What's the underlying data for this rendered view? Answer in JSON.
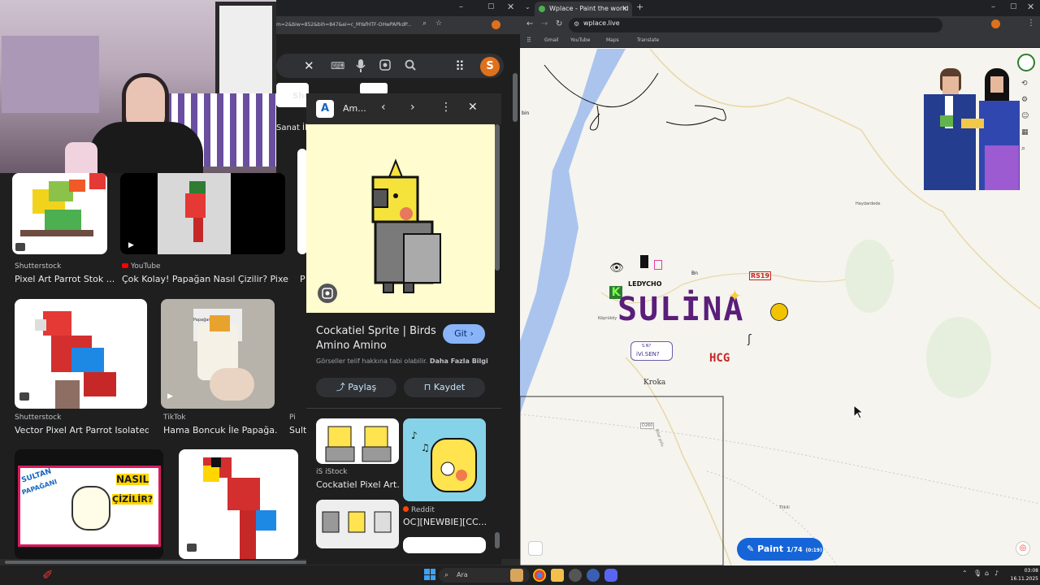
{
  "left_browser": {
    "url_fragment": "m=2&biw=852&bih=847&ei=c_MYafHTF-OHwPAPkdP...",
    "profile_initial": "S",
    "visible_tab_fragments": [
      "Shu",
      "Sanat İl"
    ],
    "results": [
      {
        "source": "Shutterstock",
        "title": "Pixel Art Parrot Stok ..."
      },
      {
        "source": "YouTube",
        "title": "Çok Kolay! Papağan Nasıl Çizilir? Pixe..."
      },
      {
        "source": "Shutterstock",
        "title": "Vector Pixel Art Parrot Isolated ..."
      },
      {
        "source": "TikTok",
        "title": "Hama Boncuk İle Papağa..."
      },
      {
        "source": "Pi",
        "title": "Sulta"
      },
      {
        "source": "P",
        "title": "P"
      }
    ],
    "thumb_texts": {
      "sultan_title": [
        "SULTAN",
        "PAPAĞANI",
        "NASIL",
        "ÇİZİLİR?"
      ],
      "hama_label": "Papağan 1"
    }
  },
  "side_panel": {
    "source_short": "Am...",
    "title": "Cockatiel Sprite | Birds Amino Amino",
    "go_label": "Git",
    "copyright_text": "Görseller telif hakkına tabi olabilir.",
    "more_info": "Daha Fazla Bilgi",
    "share_label": "Paylaş",
    "save_label": "Kaydet",
    "related": [
      {
        "source": "iStock",
        "title": "Cockatiel Pixel Art..."
      },
      {
        "source": "Reddit",
        "title": "OC][NEWBIE][CC..."
      }
    ]
  },
  "right_browser": {
    "tab_title": "Wplace - Paint the world",
    "url": "wplace.live",
    "bookmarks": [
      "Gmail",
      "YouTube",
      "Maps",
      "Translate"
    ],
    "paint_label": "Paint",
    "paint_count": "1/74",
    "paint_timer": "(0:19)",
    "map_labels": {
      "town1": "Haydardede",
      "town2": "Köprüköy",
      "town3": "Tilkili",
      "road": "D260",
      "road2": "Bilal yolu",
      "corner": "bin",
      "sulina": "SULİNA",
      "ledycho": "LEDYCHO",
      "rs": "RS19",
      "hcg": "HCG",
      "kroka": "Kroka",
      "ivi": "S.N?",
      "ivi2": "iVi.SEN?",
      "bn": "Bn",
      "k": "K"
    }
  },
  "taskbar": {
    "search_label": "Ara",
    "time": "03:08",
    "date": "16.11.2025"
  },
  "colors": {
    "accent_blue": "#1565d8",
    "sulina_purple": "#5a1e7a",
    "water": "#aac4ee"
  }
}
